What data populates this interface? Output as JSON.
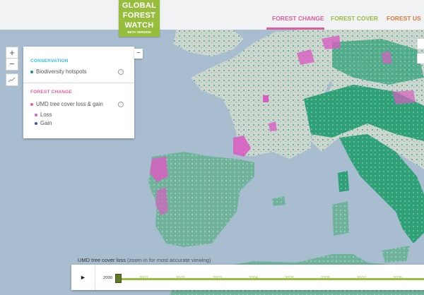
{
  "header": {
    "logo_line1": "GLOBAL",
    "logo_line2": "FOREST",
    "logo_line3": "WATCH",
    "logo_sub": "BETA VERSION",
    "nav": [
      {
        "label": "FOREST CHANGE",
        "color": "#e05c9c",
        "active": true
      },
      {
        "label": "FOREST COVER",
        "color": "#97bd3d",
        "active": false
      },
      {
        "label": "FOREST US",
        "color": "#e07a3c",
        "active": false
      }
    ]
  },
  "map_controls": {
    "zoom_in": "+",
    "zoom_out": "−"
  },
  "layers_panel": {
    "collapse_label": "−",
    "conservation": {
      "title": "CONSERVATION",
      "color": "#35c0de",
      "item": {
        "label": "Biodiversity hotspots",
        "dot_color": "#1e8f86"
      }
    },
    "forest_change": {
      "title": "FOREST CHANGE",
      "color": "#e05c9c",
      "item": {
        "label": "UMD tree cover loss & gain",
        "dot_color": "#e05c9c"
      },
      "legend": [
        {
          "label": "Loss",
          "color": "#e05cb8"
        },
        {
          "label": "Gain",
          "color": "#3b55c8"
        }
      ]
    },
    "info_glyph": "i"
  },
  "timeline": {
    "label": "UMD tree cover loss",
    "hint": "(zoom in for most accurate viewing)",
    "play_icon": "►",
    "current_year": "2000",
    "years": [
      "2001",
      "2002",
      "2003",
      "2004",
      "2005",
      "2006",
      "2007",
      "2008"
    ]
  },
  "colors": {
    "water": "#a9bdd1",
    "forest": "#3aa884",
    "loss": "#d75ec0",
    "accent_green": "#97bd3d"
  }
}
